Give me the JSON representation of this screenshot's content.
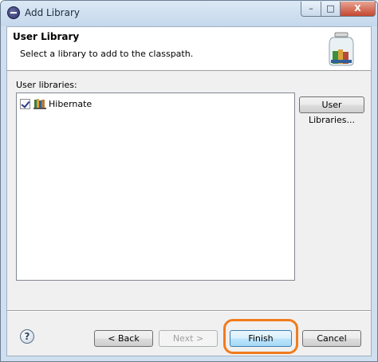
{
  "window": {
    "title": "Add Library",
    "controls": {
      "minimize": "–",
      "maximize": "□",
      "close": "X"
    }
  },
  "banner": {
    "title": "User Library",
    "description": "Select a library to add to the classpath."
  },
  "user_libraries": {
    "label": "User libraries:",
    "items": [
      {
        "label": "Hibernate",
        "checked": true
      }
    ],
    "manage_button": "User Libraries..."
  },
  "footer": {
    "help_icon": "?",
    "back_label": "< Back",
    "next_label": "Next >",
    "finish_label": "Finish",
    "cancel_label": "Cancel"
  },
  "colors": {
    "highlight": "#f07c1e",
    "accent": "#3c7fb1"
  }
}
